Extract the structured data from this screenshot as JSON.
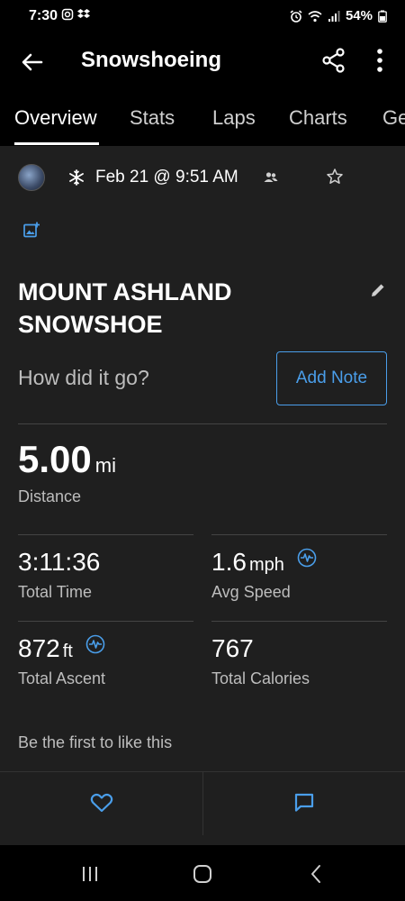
{
  "status_bar": {
    "time": "7:30",
    "battery": "54%",
    "left_icons": [
      "instagram-icon",
      "dropbox-icon"
    ],
    "right_icons": [
      "alarm-icon",
      "wifi-icon",
      "signal-icon",
      "battery-icon"
    ]
  },
  "app_bar": {
    "title": "Snowshoeing",
    "back_icon": "back-arrow-icon",
    "share_icon": "share-icon",
    "more_icon": "more-vertical-icon"
  },
  "tabs": [
    {
      "label": "Overview",
      "active": true
    },
    {
      "label": "Stats",
      "active": false
    },
    {
      "label": "Laps",
      "active": false
    },
    {
      "label": "Charts",
      "active": false
    },
    {
      "label": "Ge",
      "active": false
    }
  ],
  "activity": {
    "date": "Feb 21 @ 9:51 AM",
    "title": "MOUNT ASHLAND SNOWSHOE",
    "prompt": "How did it go?",
    "add_note_label": "Add Note"
  },
  "stats": {
    "distance": {
      "value": "5.00",
      "unit": "mi",
      "label": "Distance"
    },
    "total_time": {
      "value": "3:11:36",
      "label": "Total Time"
    },
    "avg_speed": {
      "value": "1.6",
      "unit": "mph",
      "label": "Avg Speed"
    },
    "total_ascent": {
      "value": "872",
      "unit": "ft",
      "label": "Total Ascent"
    },
    "total_calories": {
      "value": "767",
      "label": "Total Calories"
    }
  },
  "social": {
    "likes_text": "Be the first to like this"
  },
  "colors": {
    "accent": "#4a9eea",
    "background": "#1f1f1f",
    "bar": "#000000",
    "muted_text": "#bdbdbd"
  }
}
